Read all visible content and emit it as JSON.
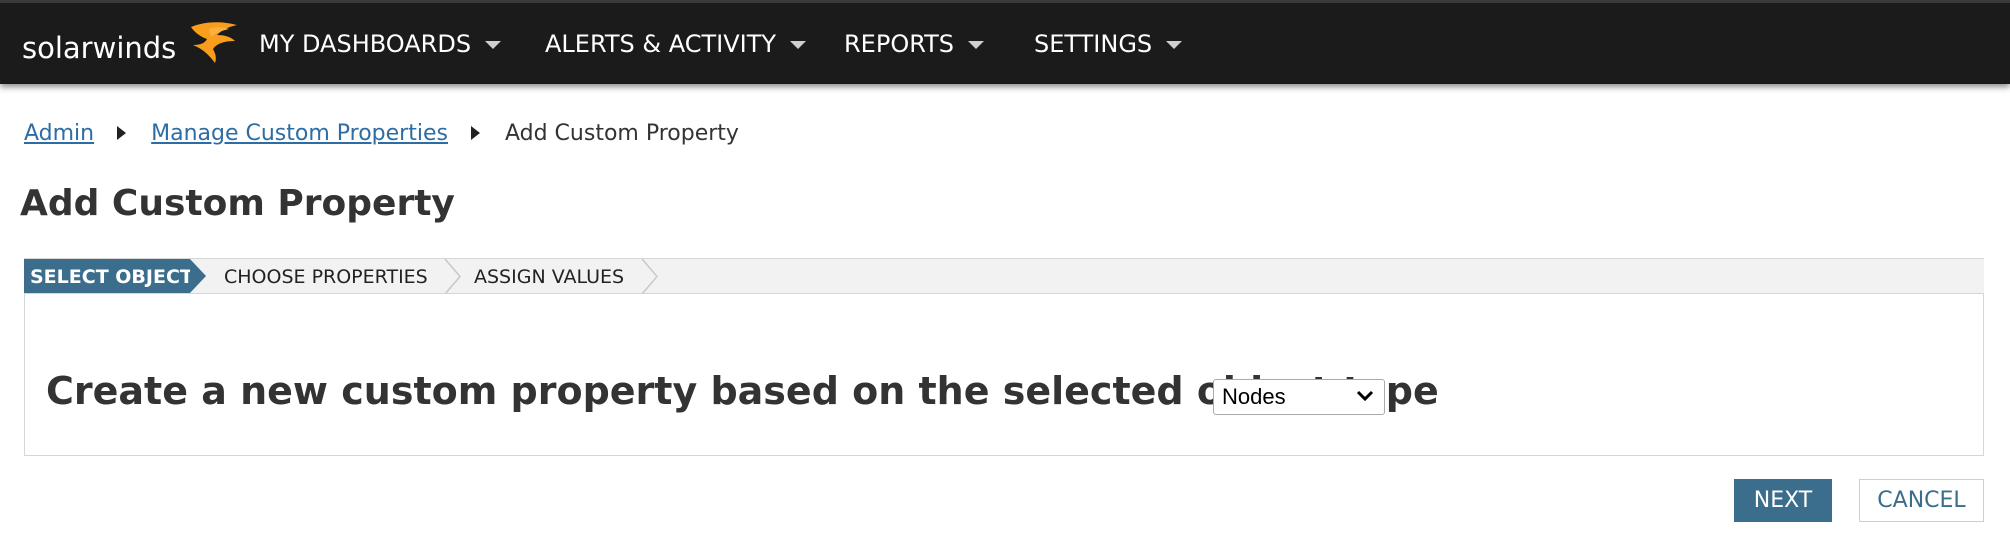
{
  "topbar": {
    "logo": {
      "text": "solarwinds",
      "icon": "solarwinds-flame-logo"
    },
    "nav": [
      {
        "label": "MY DASHBOARDS",
        "icon": "caret-down-icon"
      },
      {
        "label": "ALERTS & ACTIVITY",
        "icon": "caret-down-icon"
      },
      {
        "label": "REPORTS",
        "icon": "caret-down-icon"
      },
      {
        "label": "SETTINGS",
        "icon": "caret-down-icon"
      }
    ]
  },
  "breadcrumb": {
    "items": [
      {
        "label": "Admin"
      },
      {
        "label": "Manage Custom Properties"
      },
      {
        "label": "Add Custom Property"
      }
    ]
  },
  "page": {
    "title": "Add Custom Property"
  },
  "wizard": {
    "steps": [
      {
        "label": "SELECT OBJECT",
        "active": true
      },
      {
        "label": "CHOOSE PROPERTIES",
        "active": false
      },
      {
        "label": "ASSIGN VALUES",
        "active": false
      }
    ]
  },
  "main": {
    "prompt": "Create a new custom property based on the selected object type",
    "object_type_select": {
      "value": "Nodes"
    }
  },
  "actions": {
    "next_label": "NEXT",
    "cancel_label": "CANCEL"
  },
  "colors": {
    "topbar_bg": "#1b1b1b",
    "accent": "#3b6e8c",
    "link": "#2e6da4",
    "logo_flame": "#f99d1c"
  }
}
